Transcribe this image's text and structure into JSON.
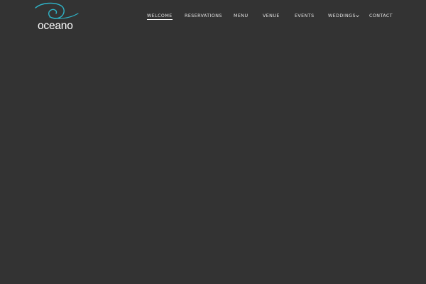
{
  "brand": {
    "name": "oceano",
    "accent": "#2fb4c8"
  },
  "nav": {
    "items": [
      {
        "label": "WELCOME",
        "active": true
      },
      {
        "label": "RESERVATIONS",
        "active": false
      },
      {
        "label": "MENU",
        "active": false
      },
      {
        "label": "VENUE",
        "active": false
      },
      {
        "label": "EVENTS",
        "active": false
      },
      {
        "label": "WEDDINGS",
        "active": false,
        "icon": "chevron-down-icon"
      },
      {
        "label": "CONTACT",
        "active": false
      }
    ]
  },
  "colors": {
    "background": "#333333",
    "nav_text": "#e6e6e6"
  }
}
